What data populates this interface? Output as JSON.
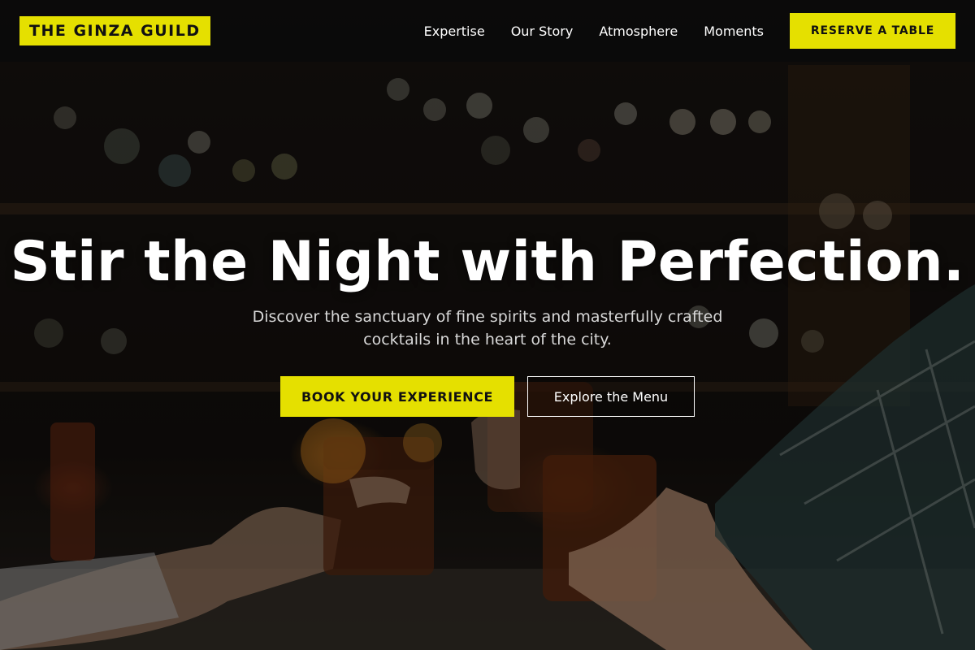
{
  "brand": {
    "name": "THE GINZA GUILD",
    "accent_color": "#e5e000"
  },
  "nav": {
    "links": [
      "Expertise",
      "Our Story",
      "Atmosphere",
      "Moments"
    ],
    "cta_label": "RESERVE A TABLE"
  },
  "hero": {
    "headline": "Stir the Night with Perfection.",
    "subtext": "Discover the sanctuary of fine spirits and masterfully crafted cocktails in the heart of the city.",
    "primary_cta": "BOOK YOUR EXPERIENCE",
    "secondary_cta": "Explore the Menu",
    "background_image": "bar-toast-photo"
  }
}
